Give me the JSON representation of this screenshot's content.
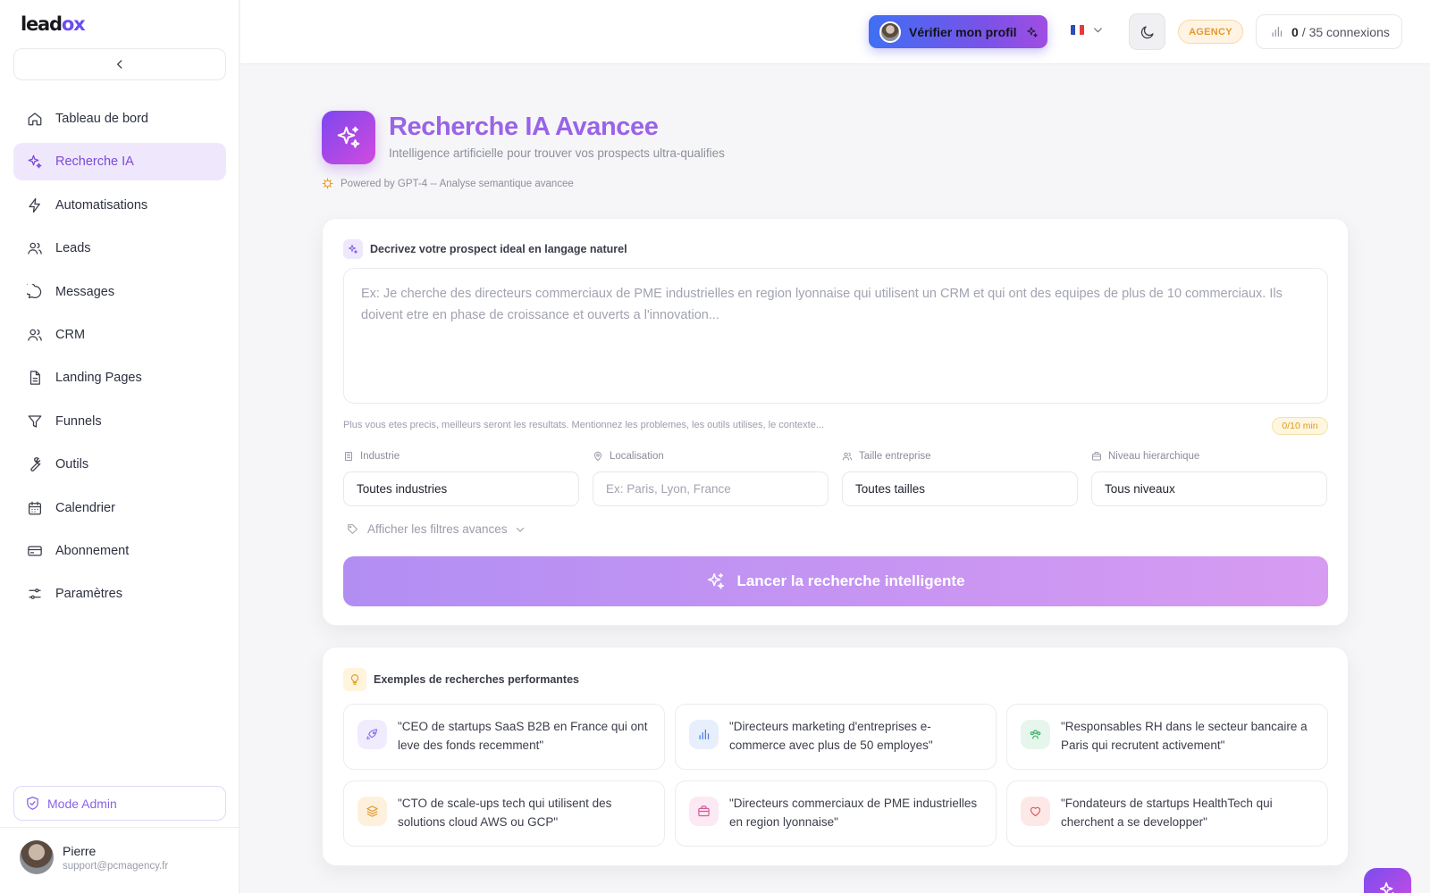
{
  "app": {
    "logo_main": "lead",
    "logo_accent": "ox"
  },
  "sidebar": {
    "items": [
      {
        "label": "Tableau de bord",
        "icon": "home-icon"
      },
      {
        "label": "Recherche IA",
        "icon": "sparkles-icon",
        "active": true
      },
      {
        "label": "Automatisations",
        "icon": "bolt-icon"
      },
      {
        "label": "Leads",
        "icon": "users-icon"
      },
      {
        "label": "Messages",
        "icon": "chat-icon"
      },
      {
        "label": "CRM",
        "icon": "users-icon"
      },
      {
        "label": "Landing Pages",
        "icon": "document-icon"
      },
      {
        "label": "Funnels",
        "icon": "funnel-icon"
      },
      {
        "label": "Outils",
        "icon": "wrench-icon"
      },
      {
        "label": "Calendrier",
        "icon": "calendar-icon"
      },
      {
        "label": "Abonnement",
        "icon": "credit-card-icon"
      },
      {
        "label": "Paramètres",
        "icon": "sliders-icon"
      }
    ],
    "admin_label": "Mode Admin",
    "user": {
      "name": "Pierre",
      "email": "support@pcmagency.fr"
    }
  },
  "topbar": {
    "verify_label": "Vérifier mon profil",
    "plan_badge": "AGENCY",
    "connections_used": "0",
    "connections_total": "/ 35 connexions"
  },
  "header": {
    "title": "Recherche IA Avancee",
    "subtitle": "Intelligence artificielle pour trouver vos prospects ultra-qualifies",
    "powered": "Powered by GPT-4 -- Analyse semantique avancee"
  },
  "search": {
    "section_title": "Decrivez votre prospect ideal en langage naturel",
    "placeholder": "Ex: Je cherche des directeurs commerciaux de PME industrielles en region lyonnaise qui utilisent un CRM et qui ont des equipes de plus de 10 commerciaux. Ils doivent etre en phase de croissance et ouverts a l'innovation...",
    "hint": "Plus vous etes precis, meilleurs seront les resultats. Mentionnez les problemes, les outils utilises, le contexte...",
    "counter": "0/10 min",
    "filters": [
      {
        "label": "Industrie",
        "value": "Toutes industries",
        "placeholder": false
      },
      {
        "label": "Localisation",
        "value": "Ex: Paris, Lyon, France",
        "placeholder": true
      },
      {
        "label": "Taille entreprise",
        "value": "Toutes tailles",
        "placeholder": false
      },
      {
        "label": "Niveau hierarchique",
        "value": "Tous niveaux",
        "placeholder": false
      }
    ],
    "advanced_label": "Afficher les filtres avances",
    "launch_label": "Lancer la recherche intelligente"
  },
  "examples": {
    "title": "Exemples de recherches performantes",
    "items": [
      {
        "text": "\"CEO de startups SaaS B2B en France qui ont leve des fonds recemment\"",
        "icon": "rocket-icon",
        "color": "#8b6ef0",
        "bg": "#f0ebfd"
      },
      {
        "text": "\"Directeurs marketing d'entreprises e-commerce avec plus de 50 employes\"",
        "icon": "bar-chart-icon",
        "color": "#4a7de8",
        "bg": "#e8effc"
      },
      {
        "text": "\"Responsables RH dans le secteur bancaire a Paris qui recrutent activement\"",
        "icon": "users-icon",
        "color": "#3fae6b",
        "bg": "#e6f6ec"
      },
      {
        "text": "\"CTO de scale-ups tech qui utilisent des solutions cloud AWS ou GCP\"",
        "icon": "layers-icon",
        "color": "#e39a2a",
        "bg": "#fdf1de"
      },
      {
        "text": "\"Directeurs commerciaux de PME industrielles en region lyonnaise\"",
        "icon": "briefcase-icon",
        "color": "#d45a9c",
        "bg": "#fce9f3"
      },
      {
        "text": "\"Fondateurs de startups HealthTech qui cherchent a se developper\"",
        "icon": "heart-icon",
        "color": "#e25757",
        "bg": "#fde8e8"
      }
    ]
  },
  "colors": {
    "accent": "#9a63e8",
    "active_bg": "#efe8fc",
    "launch_start": "#b28ef3",
    "launch_end": "#d79bf2"
  }
}
